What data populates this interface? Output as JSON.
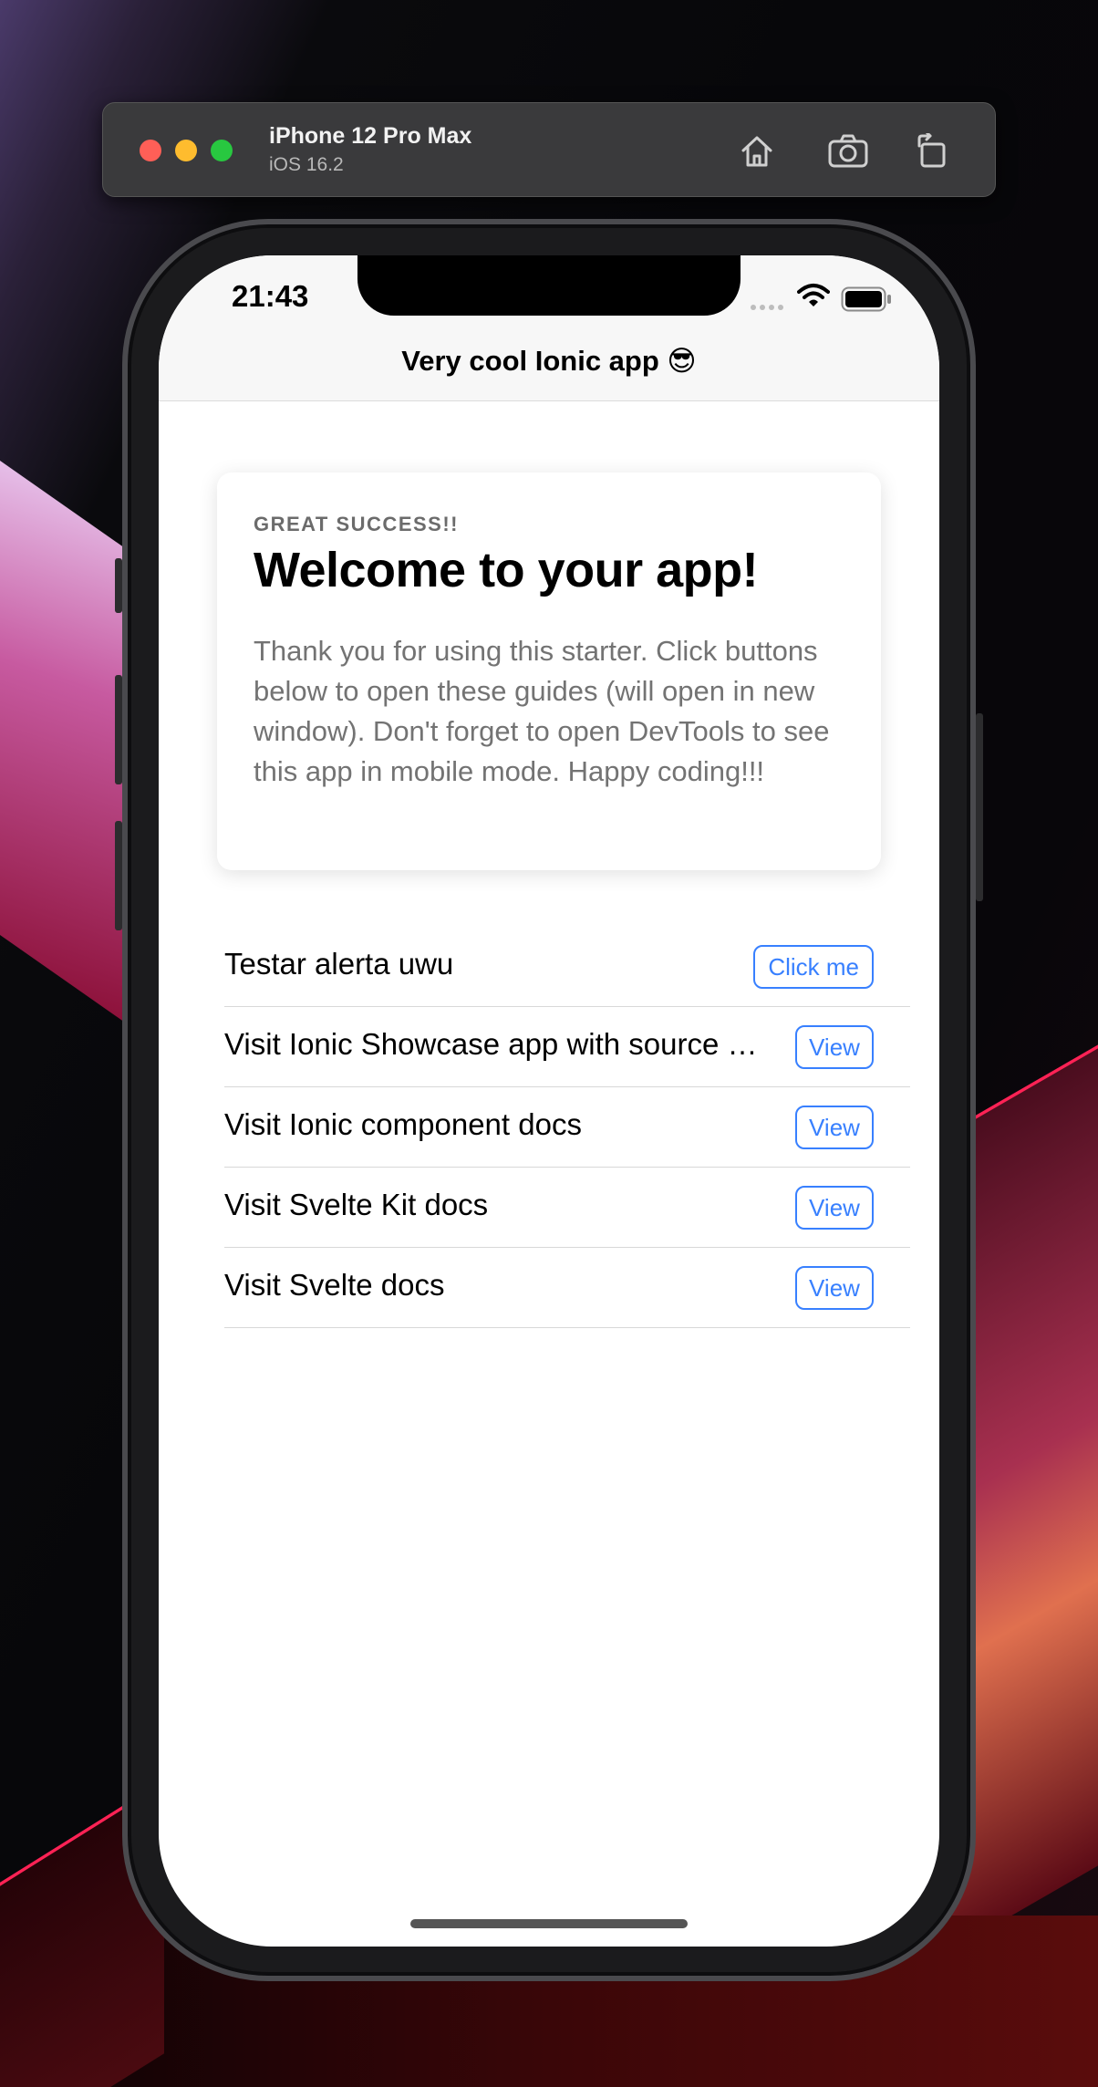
{
  "simulator": {
    "device_name": "iPhone 12 Pro Max",
    "os_version": "iOS 16.2",
    "icons": {
      "home": "home-icon",
      "screenshot": "camera-icon",
      "rotate": "rotate-icon"
    }
  },
  "status_bar": {
    "time": "21:43"
  },
  "toolbar": {
    "title": "Very cool Ionic app 😎"
  },
  "card": {
    "subtitle": "GREAT SUCCESS!!",
    "title": "Welcome to your app!",
    "body": "Thank you for using this starter. Click buttons below to open these guides (will open in new window). Don't forget to open DevTools to see this app in mobile mode. Happy coding!!!"
  },
  "list": {
    "items": [
      {
        "label": "Testar alerta uwu",
        "button": "Click me"
      },
      {
        "label": "Visit Ionic Showcase app with source code",
        "button": "View"
      },
      {
        "label": "Visit Ionic component docs",
        "button": "View"
      },
      {
        "label": "Visit Svelte Kit docs",
        "button": "View"
      },
      {
        "label": "Visit Svelte docs",
        "button": "View"
      }
    ]
  },
  "colors": {
    "accent": "#3880ff",
    "toolbar_bg": "#f7f7f7",
    "card_body_text": "#737373"
  }
}
